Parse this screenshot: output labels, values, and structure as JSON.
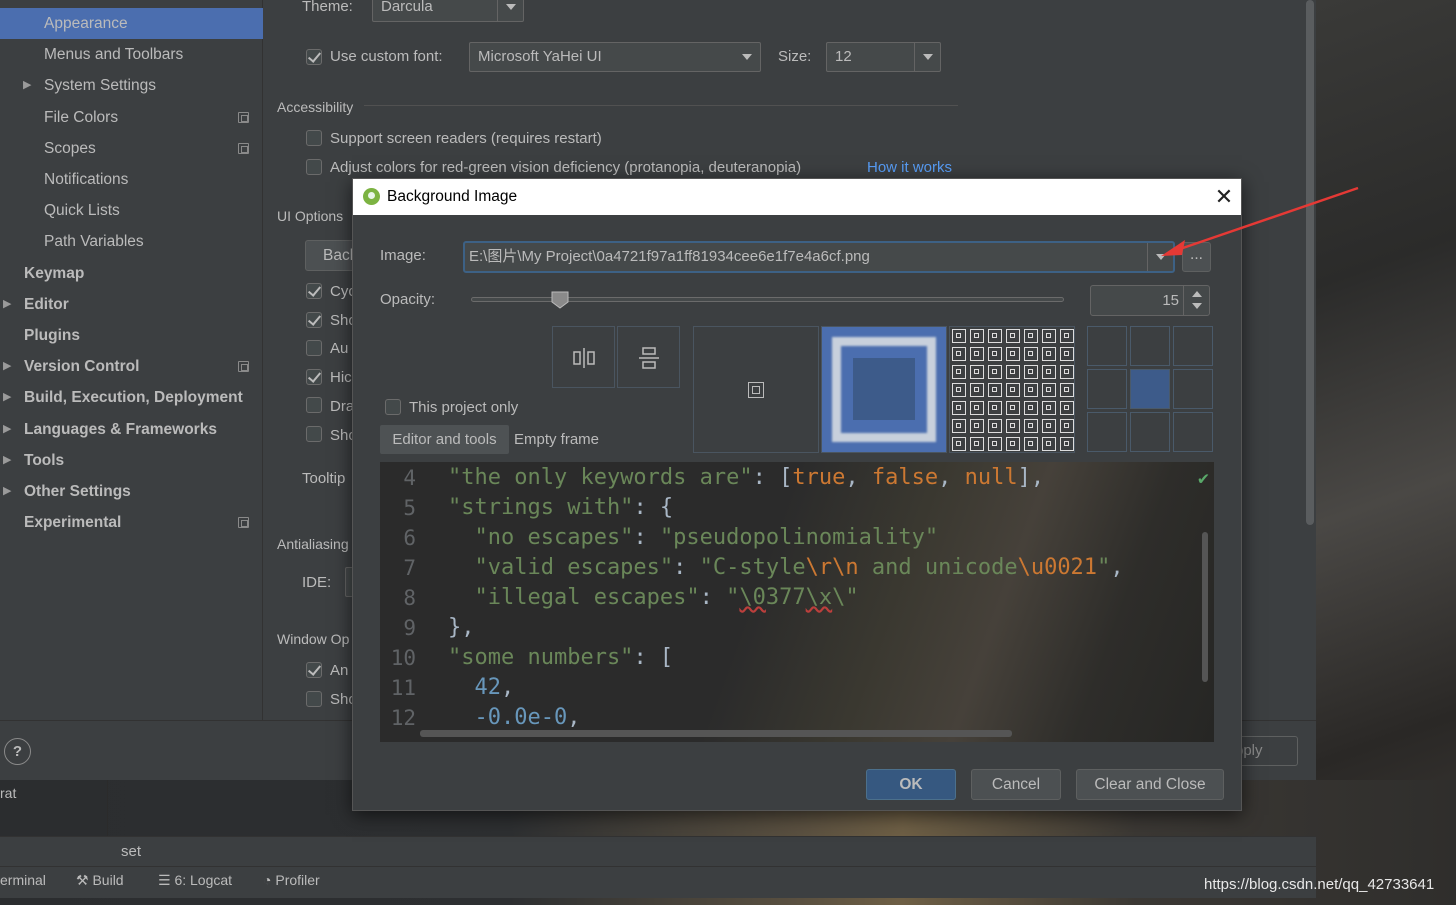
{
  "sidebar": {
    "items": [
      {
        "label": "Appearance",
        "level": 2,
        "selected": true
      },
      {
        "label": "Menus and Toolbars",
        "level": 2
      },
      {
        "label": "System Settings",
        "level": 2,
        "arrow": true
      },
      {
        "label": "File Colors",
        "level": 2,
        "cfg": true
      },
      {
        "label": "Scopes",
        "level": 2,
        "cfg": true
      },
      {
        "label": "Notifications",
        "level": 2
      },
      {
        "label": "Quick Lists",
        "level": 2
      },
      {
        "label": "Path Variables",
        "level": 2
      },
      {
        "label": "Keymap",
        "level": 1,
        "bold": true
      },
      {
        "label": "Editor",
        "level": 1,
        "bold": true,
        "arrow": true
      },
      {
        "label": "Plugins",
        "level": 1,
        "bold": true
      },
      {
        "label": "Version Control",
        "level": 1,
        "bold": true,
        "arrow": true,
        "cfg": true
      },
      {
        "label": "Build, Execution, Deployment",
        "level": 1,
        "bold": true,
        "arrow": true
      },
      {
        "label": "Languages & Frameworks",
        "level": 1,
        "bold": true,
        "arrow": true
      },
      {
        "label": "Tools",
        "level": 1,
        "bold": true,
        "arrow": true
      },
      {
        "label": "Other Settings",
        "level": 1,
        "bold": true,
        "arrow": true
      },
      {
        "label": "Experimental",
        "level": 1,
        "bold": true,
        "cfg": true
      }
    ]
  },
  "main": {
    "theme_label": "Theme:",
    "theme_value": "Darcula",
    "custom_font_label": "Use custom font:",
    "font_value": "Microsoft YaHei UI",
    "size_label": "Size:",
    "size_value": "12",
    "accessibility_header": "Accessibility",
    "screen_readers": "Support screen readers (requires restart)",
    "adjust_colors": "Adjust colors for red-green vision deficiency (protanopia, deuteranopia)",
    "how_it_works": "How it works",
    "ui_options_header": "UI Options",
    "back_btn": "Back",
    "cut_labels": [
      "Cyc",
      "Sho",
      "Au",
      "Hic",
      "Dra",
      "Sho"
    ],
    "tooltip_label": "Tooltip",
    "antialiasing_header": "Antialiasing",
    "ide_label": "IDE:",
    "window_options_header": "Window Op",
    "win_cut_labels": [
      "An",
      "Sho"
    ],
    "apply_label": "pply"
  },
  "footer": {
    "help": "?",
    "left_cut": "rat",
    "set_text": "set",
    "tools": [
      "erminal",
      "Build",
      "6: Logcat",
      "Profiler"
    ],
    "watermark": "https://blog.csdn.net/qq_42733641"
  },
  "dialog": {
    "title": "Background Image",
    "image_label": "Image:",
    "image_path": "E:\\图片\\My Project\\0a4721f97a1ff81934cee6e1f7e4a6cf.png",
    "browse": "...",
    "opacity_label": "Opacity:",
    "opacity_value": 15,
    "this_project_only": "This project only",
    "tab_editor": "Editor and tools",
    "tab_empty": "Empty frame",
    "ok": "OK",
    "cancel": "Cancel",
    "clear_close": "Clear and Close"
  },
  "editor": {
    "lines": [
      4,
      5,
      6,
      7,
      8,
      9,
      10,
      11,
      12
    ]
  },
  "colors": {
    "accent": "#4b6eaf",
    "string": "#6a8759",
    "keyword": "#cc7832",
    "number": "#6897bb",
    "arrow": "#e53935"
  }
}
